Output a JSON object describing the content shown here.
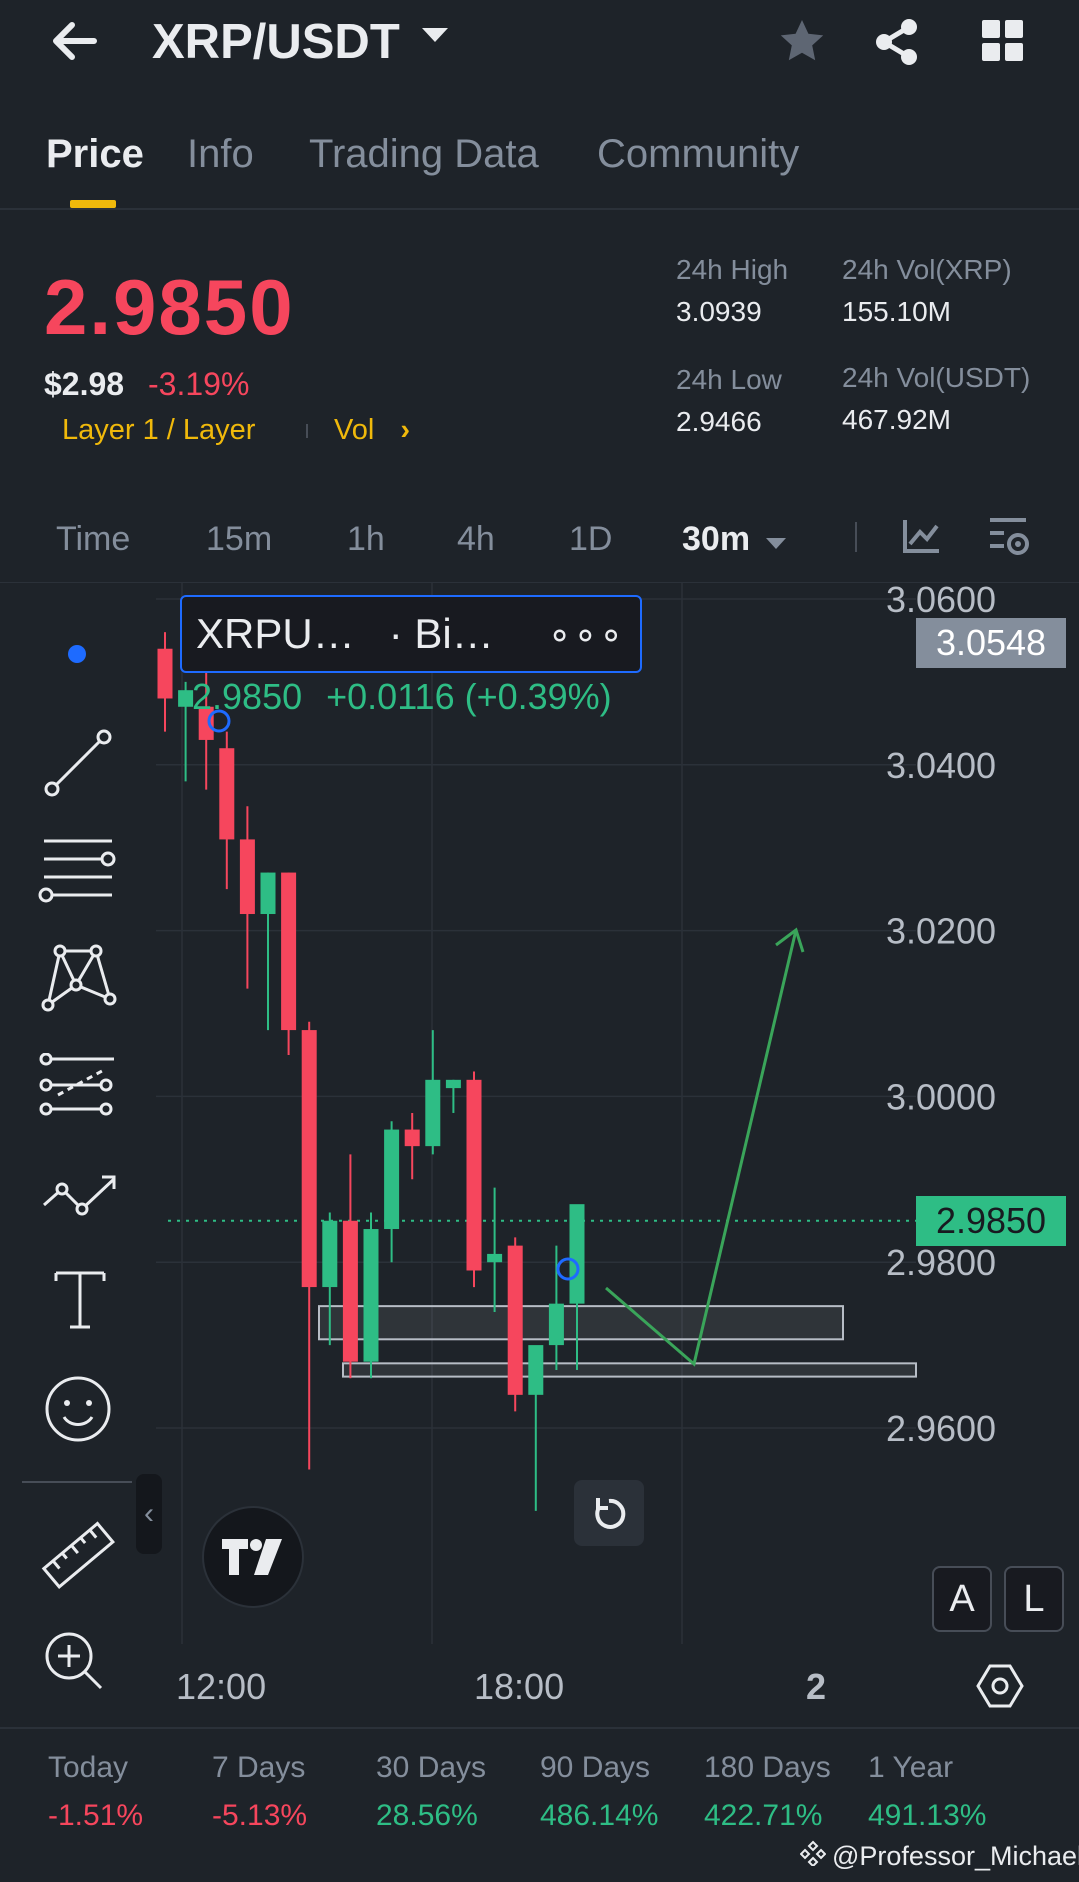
{
  "header": {
    "pair": "XRP/USDT",
    "tabs": [
      "Price",
      "Info",
      "Trading Data",
      "Community"
    ],
    "active_tab": "Price"
  },
  "price": {
    "last": "2.9850",
    "usd": "$2.98",
    "change": "-3.19%",
    "category": "Layer 1 / Layer",
    "vol_link": "Vol",
    "stats": {
      "high_label": "24h High",
      "high": "3.0939",
      "low_label": "24h Low",
      "low": "2.9466",
      "vol_xrp_label": "24h Vol(XRP)",
      "vol_xrp": "155.10M",
      "vol_usdt_label": "24h Vol(USDT)",
      "vol_usdt": "467.92M"
    }
  },
  "timeframes": {
    "items": [
      "Time",
      "15m",
      "1h",
      "4h",
      "1D"
    ],
    "selected": "30m"
  },
  "chart": {
    "legend_symbol": "XRPU…",
    "legend_exchange": "· Bi…",
    "legend_more": "∘∘∘",
    "legend_price": "2.9850",
    "legend_change": "+0.0116 (+0.39%)",
    "crosshair_price": "3.0548",
    "last_price_label": "2.9850",
    "y_ticks": [
      "3.0600",
      "3.0400",
      "3.0200",
      "3.0000",
      "2.9800",
      "2.9600"
    ],
    "x_ticks": [
      "12:00",
      "18:00",
      "2"
    ],
    "btn_auto": "A",
    "btn_log": "L",
    "colors": {
      "up": "#2ebd85",
      "down": "#f6465d",
      "accent": "#f0b90b"
    }
  },
  "chart_data": {
    "type": "candlestick",
    "ylim": [
      2.945,
      3.07
    ],
    "y_ticks": [
      3.06,
      3.04,
      3.02,
      3.0,
      2.98,
      2.96
    ],
    "x_ticks": [
      "12:00",
      "18:00",
      "2"
    ],
    "last_price": 2.985,
    "candles": [
      {
        "o": 3.054,
        "h": 3.056,
        "l": 3.044,
        "c": 3.048
      },
      {
        "o": 3.047,
        "h": 3.05,
        "l": 3.038,
        "c": 3.049
      },
      {
        "o": 3.047,
        "h": 3.052,
        "l": 3.037,
        "c": 3.043
      },
      {
        "o": 3.042,
        "h": 3.044,
        "l": 3.025,
        "c": 3.031
      },
      {
        "o": 3.031,
        "h": 3.035,
        "l": 3.013,
        "c": 3.022
      },
      {
        "o": 3.022,
        "h": 3.027,
        "l": 3.008,
        "c": 3.027
      },
      {
        "o": 3.027,
        "h": 3.027,
        "l": 3.005,
        "c": 3.008
      },
      {
        "o": 3.008,
        "h": 3.009,
        "l": 2.955,
        "c": 2.977
      },
      {
        "o": 2.977,
        "h": 2.986,
        "l": 2.97,
        "c": 2.985
      },
      {
        "o": 2.985,
        "h": 2.993,
        "l": 2.966,
        "c": 2.968
      },
      {
        "o": 2.968,
        "h": 2.986,
        "l": 2.966,
        "c": 2.984
      },
      {
        "o": 2.984,
        "h": 2.997,
        "l": 2.98,
        "c": 2.996
      },
      {
        "o": 2.996,
        "h": 2.998,
        "l": 2.99,
        "c": 2.994
      },
      {
        "o": 2.994,
        "h": 3.008,
        "l": 2.993,
        "c": 3.002
      },
      {
        "o": 3.001,
        "h": 3.002,
        "l": 2.998,
        "c": 3.002
      },
      {
        "o": 3.002,
        "h": 3.003,
        "l": 2.977,
        "c": 2.979
      },
      {
        "o": 2.98,
        "h": 2.989,
        "l": 2.974,
        "c": 2.981
      },
      {
        "o": 2.982,
        "h": 2.983,
        "l": 2.962,
        "c": 2.964
      },
      {
        "o": 2.964,
        "h": 2.969,
        "l": 2.95,
        "c": 2.97
      },
      {
        "o": 2.97,
        "h": 2.982,
        "l": 2.967,
        "c": 2.975
      },
      {
        "o": 2.975,
        "h": 2.98,
        "l": 2.967,
        "c": 2.987
      }
    ],
    "zones": [
      {
        "from": 2.9707,
        "to": 2.9747
      },
      {
        "from": 2.9662,
        "to": 2.9678
      }
    ]
  },
  "toolbar": {
    "tools": [
      "dot-icon",
      "trendline-icon",
      "horizontal-lines-icon",
      "pattern-icon",
      "fib-icon",
      "path-icon",
      "text-icon",
      "emoji-icon",
      "ruler-icon",
      "zoom-in-icon"
    ]
  },
  "performance": {
    "items": [
      {
        "label": "Today",
        "value": "-1.51%",
        "dir": "down"
      },
      {
        "label": "7 Days",
        "value": "-5.13%",
        "dir": "down"
      },
      {
        "label": "30 Days",
        "value": "28.56%",
        "dir": "up"
      },
      {
        "label": "90 Days",
        "value": "486.14%",
        "dir": "up"
      },
      {
        "label": "180 Days",
        "value": "422.71%",
        "dir": "up"
      },
      {
        "label": "1 Year",
        "value": "491.13%",
        "dir": "up"
      }
    ]
  },
  "watermark": "@Professor_Michael"
}
